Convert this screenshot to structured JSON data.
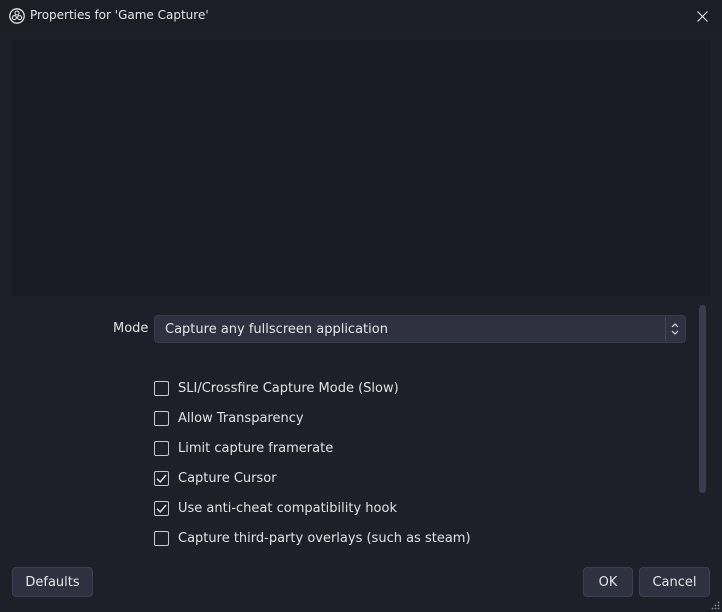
{
  "window": {
    "title": "Properties for 'Game Capture'",
    "logo_icon": "obs-logo-icon",
    "close_icon": "close-icon"
  },
  "form": {
    "mode_label": "Mode",
    "mode_value": "Capture any fullscreen application",
    "checkboxes": [
      {
        "label": "SLI/Crossfire Capture Mode (Slow)",
        "checked": false
      },
      {
        "label": "Allow Transparency",
        "checked": false
      },
      {
        "label": "Limit capture framerate",
        "checked": false
      },
      {
        "label": "Capture Cursor",
        "checked": true
      },
      {
        "label": "Use anti-cheat compatibility hook",
        "checked": true
      },
      {
        "label": "Capture third-party overlays (such as steam)",
        "checked": false
      }
    ]
  },
  "buttons": {
    "defaults": "Defaults",
    "ok": "OK",
    "cancel": "Cancel"
  },
  "colors": {
    "background": "#1e1f29",
    "preview": "#191a23",
    "control": "#2f3040"
  }
}
